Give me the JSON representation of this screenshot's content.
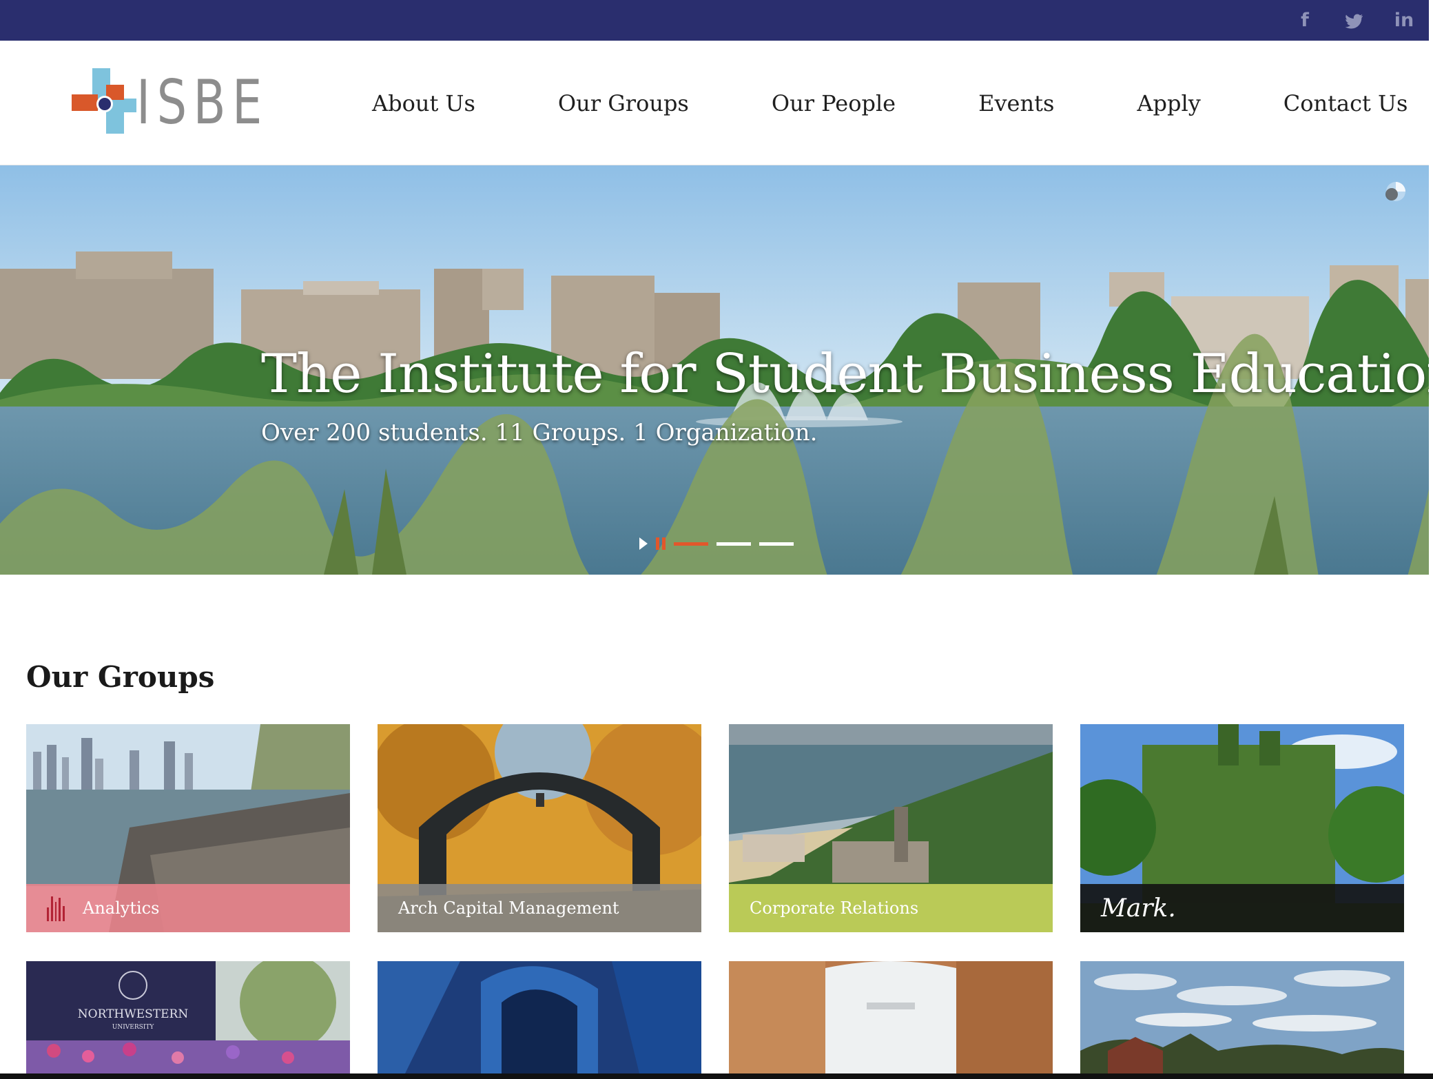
{
  "social": {
    "icons": [
      "facebook-icon",
      "twitter-icon",
      "linkedin-icon"
    ],
    "glyphs": [
      "f",
      "🐦",
      "in"
    ]
  },
  "brand": {
    "name": "ISBE"
  },
  "nav": {
    "items": [
      "About Us",
      "Our Groups",
      "Our People",
      "Events",
      "Apply",
      "Contact Us"
    ]
  },
  "hero": {
    "title": "The Institute for Student Business Education",
    "subtitle": "Over 200 students. 11 Groups. 1 Organization.",
    "slides": 3,
    "active_slide": 1
  },
  "groups": {
    "heading": "Our Groups",
    "cards": [
      {
        "label": "Analytics",
        "band_color": "#e8838c"
      },
      {
        "label": "Arch Capital Management",
        "band_color": "#8a8a8a"
      },
      {
        "label": "Corporate Relations",
        "band_color": "#c4d35a"
      },
      {
        "label": "Mark.",
        "band_color": "#1a1a1a"
      },
      {
        "label": "",
        "band_color": ""
      },
      {
        "label": "",
        "band_color": ""
      },
      {
        "label": "",
        "band_color": ""
      },
      {
        "label": "",
        "band_color": ""
      }
    ],
    "photo_text": {
      "northwestern_sign": "NORTHWESTERN",
      "northwestern_sub": "UNIVERSITY"
    }
  },
  "colors": {
    "topbar": "#2a2e6e",
    "accent": "#e2572b",
    "logo_blue": "#7ec3dd",
    "logo_orange": "#d9582a",
    "logo_navy": "#2a2e6e"
  }
}
